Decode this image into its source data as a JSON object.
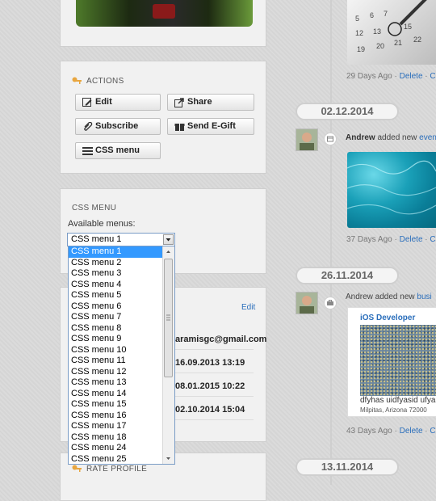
{
  "actions": {
    "title": "ACTIONS",
    "buttons": {
      "edit": "Edit",
      "share": "Share",
      "subscribe": "Subscribe",
      "send_egift": "Send E-Gift",
      "css_menu": "CSS menu"
    }
  },
  "css_menu": {
    "title": "CSS MENU",
    "available_label": "Available menus:",
    "selected": "CSS menu 1",
    "options": [
      "CSS menu 1",
      "CSS menu 2",
      "CSS menu 3",
      "CSS menu 4",
      "CSS menu 5",
      "CSS menu 6",
      "CSS menu 7",
      "CSS menu 8",
      "CSS menu 9",
      "CSS menu 10",
      "CSS menu 11",
      "CSS menu 12",
      "CSS menu 13",
      "CSS menu 14",
      "CSS menu 15",
      "CSS menu 16",
      "CSS menu 17",
      "CSS menu 18",
      "CSS menu 24",
      "CSS menu 25"
    ]
  },
  "info": {
    "edit_link": "Edit",
    "email": "aramisgc@gmail.com",
    "dates": [
      "16.09.2013 13:19",
      "08.01.2015 10:22",
      "02.10.2014 15:04"
    ]
  },
  "rate_profile": {
    "title": "RATE PROFILE"
  },
  "timeline": {
    "top_meta": {
      "age": "29 Days Ago",
      "delete": "Delete",
      "comment": "C"
    },
    "entries": [
      {
        "date": "02.12.2014",
        "author": "Andrew",
        "action": " added new ",
        "link": "event",
        "meta": {
          "age": "37 Days Ago",
          "delete": "Delete",
          "comment": "C"
        }
      },
      {
        "date": "26.11.2014",
        "author": "Andrew",
        "action": " added new ",
        "link": "busi",
        "job": {
          "title": "iOS Developer",
          "description": "dfyhas uidfyasid ufya",
          "location": "Milpitas, Arizona 72000"
        },
        "meta": {
          "age": "43 Days Ago",
          "delete": "Delete",
          "comment": "C"
        }
      }
    ],
    "last_date": "13.11.2014"
  },
  "colors": {
    "link": "#2a6ebb",
    "selection": "#3399ff",
    "key_icon": "#e8a640"
  }
}
